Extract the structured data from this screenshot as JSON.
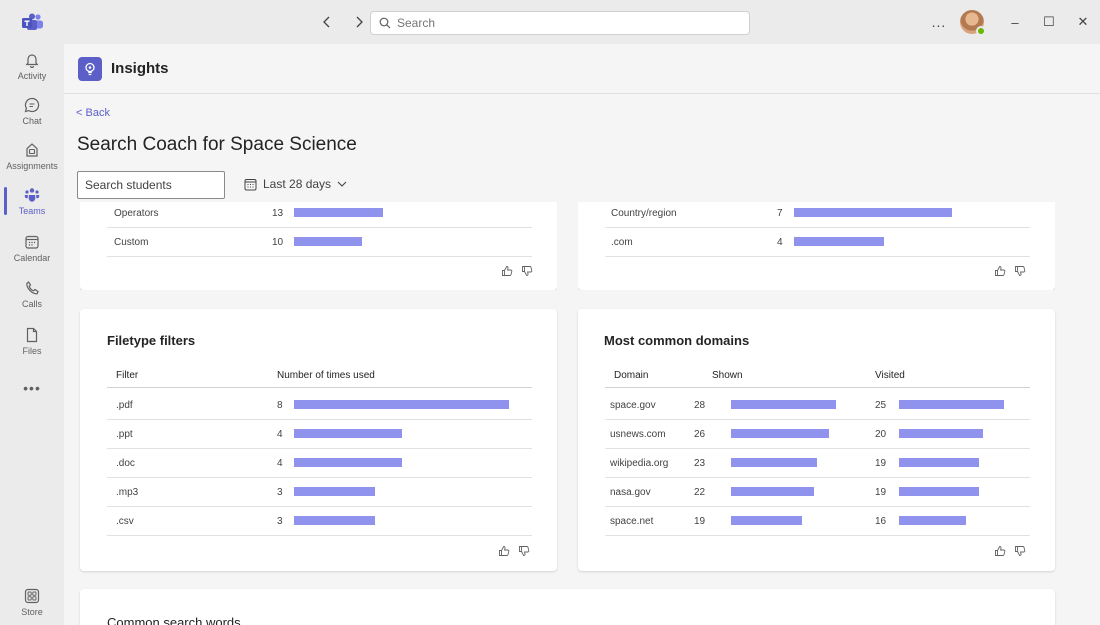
{
  "titlebar": {
    "search_placeholder": "Search",
    "more": "...",
    "minimize": "–",
    "maximize": "☐",
    "close": "✕"
  },
  "rail": {
    "items": [
      {
        "label": "Activity",
        "icon": "bell-icon"
      },
      {
        "label": "Chat",
        "icon": "chat-icon"
      },
      {
        "label": "Assignments",
        "icon": "assignments-icon"
      },
      {
        "label": "Teams",
        "icon": "teams-icon",
        "active": true
      },
      {
        "label": "Calendar",
        "icon": "calendar-icon"
      },
      {
        "label": "Calls",
        "icon": "phone-icon"
      },
      {
        "label": "Files",
        "icon": "file-icon"
      }
    ],
    "more": "•••",
    "store_label": "Store"
  },
  "app": {
    "title": "Insights",
    "back": "Back",
    "page_title": "Search Coach for Space Science",
    "search_placeholder": "Search students",
    "date_filter": "Last 28 days"
  },
  "colors": {
    "accent": "#5b5fc7",
    "bar": "#8f93ee"
  },
  "cards": {
    "advanced_filters": {
      "max": 13,
      "rows": [
        {
          "label": "Operators",
          "value": "13",
          "num": 13
        },
        {
          "label": "Custom",
          "value": "10",
          "num": 10
        }
      ]
    },
    "domain_filters": {
      "max": 7,
      "rows": [
        {
          "label": "Country/region",
          "value": "7",
          "num": 7
        },
        {
          "label": ".com",
          "value": "4",
          "num": 4
        }
      ]
    },
    "filetype": {
      "title": "Filetype filters",
      "col_filter": "Filter",
      "col_times": "Number of times used",
      "max": 8,
      "rows": [
        {
          "label": ".pdf",
          "value": "8",
          "num": 8
        },
        {
          "label": ".ppt",
          "value": "4",
          "num": 4
        },
        {
          "label": ".doc",
          "value": "4",
          "num": 4
        },
        {
          "label": ".mp3",
          "value": "3",
          "num": 3
        },
        {
          "label": ".csv",
          "value": "3",
          "num": 3
        }
      ]
    },
    "domains": {
      "title": "Most common domains",
      "col_domain": "Domain",
      "col_shown": "Shown",
      "col_visited": "Visited",
      "max": 28,
      "rows": [
        {
          "domain": "space.gov",
          "shown": "28",
          "shown_num": 28,
          "visited": "25",
          "visited_num": 25
        },
        {
          "domain": "usnews.com",
          "shown": "26",
          "shown_num": 26,
          "visited": "20",
          "visited_num": 20
        },
        {
          "domain": "wikipedia.org",
          "shown": "23",
          "shown_num": 23,
          "visited": "19",
          "visited_num": 19
        },
        {
          "domain": "nasa.gov",
          "shown": "22",
          "shown_num": 22,
          "visited": "19",
          "visited_num": 19
        },
        {
          "domain": "space.net",
          "shown": "19",
          "shown_num": 19,
          "visited": "16",
          "visited_num": 16
        }
      ]
    },
    "search_words": {
      "title": "Common search words"
    }
  }
}
